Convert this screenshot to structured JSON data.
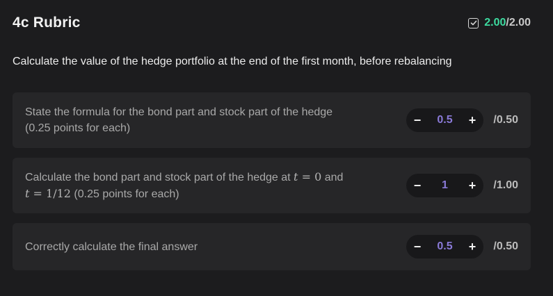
{
  "header": {
    "title": "4c Rubric",
    "score_earned": "2.00",
    "score_separator": "/",
    "score_total": "2.00"
  },
  "question": "Calculate the value of the hedge portfolio at the end of the first month, before rebalancing",
  "criteria": [
    {
      "text_line1": "State the formula for the bond part and stock part of the hedge",
      "text_line2": "(0.25 points for each)",
      "value": "0.5",
      "max": "/0.50"
    },
    {
      "text_pre": "Calculate the bond part and stock part of the hedge at ",
      "math_t": "t",
      "math_eq0": " = 0",
      "text_and": " and",
      "math_eq1": " = 1/12",
      "text_post": " (0.25 points for each)",
      "value": "1",
      "max": "/1.00"
    },
    {
      "text_line1": "Correctly calculate the final answer",
      "value": "0.5",
      "max": "/0.50"
    }
  ],
  "stepper": {
    "minus_label": "−",
    "plus_label": "+"
  },
  "colors": {
    "earned": "#3ddba0",
    "value": "#8a7ad8",
    "card": "#262628",
    "background": "#1c1c1e"
  }
}
